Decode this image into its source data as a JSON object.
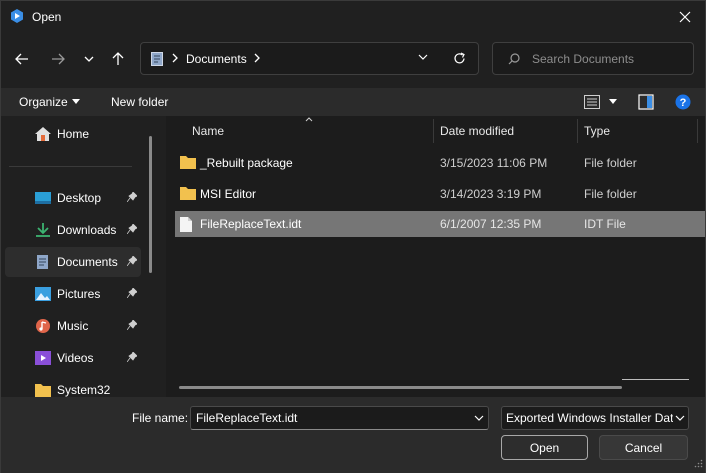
{
  "window": {
    "title": "Open"
  },
  "address": {
    "segment": "Documents"
  },
  "search": {
    "placeholder": "Search Documents"
  },
  "commands": {
    "organize": "Organize",
    "new_folder": "New folder"
  },
  "sidebar": {
    "items": [
      {
        "label": "Home",
        "icon": "home-icon",
        "pinned": false
      },
      {
        "label": "Desktop",
        "icon": "desktop-icon",
        "pinned": true
      },
      {
        "label": "Downloads",
        "icon": "downloads-icon",
        "pinned": true
      },
      {
        "label": "Documents",
        "icon": "documents-icon",
        "pinned": true,
        "selected": true
      },
      {
        "label": "Pictures",
        "icon": "pictures-icon",
        "pinned": true
      },
      {
        "label": "Music",
        "icon": "music-icon",
        "pinned": true
      },
      {
        "label": "Videos",
        "icon": "videos-icon",
        "pinned": true
      },
      {
        "label": "System32",
        "icon": "folder-icon",
        "pinned": false
      }
    ]
  },
  "columns": {
    "name": "Name",
    "date": "Date modified",
    "type": "Type"
  },
  "files": [
    {
      "name": "_Rebuilt package",
      "date": "3/15/2023 11:06 PM",
      "type": "File folder",
      "kind": "folder"
    },
    {
      "name": "MSI Editor",
      "date": "3/14/2023 3:19 PM",
      "type": "File folder",
      "kind": "folder"
    },
    {
      "name": "FileReplaceText.idt",
      "date": "6/1/2007 12:35 PM",
      "type": "IDT File",
      "kind": "file",
      "selected": true
    }
  ],
  "footer": {
    "file_name_label": "File name:",
    "file_name_value": "FileReplaceText.idt",
    "file_type": "Exported Windows Installer Dat",
    "open_label": "Open",
    "cancel_label": "Cancel"
  },
  "colors": {
    "accent": "#1a73e8",
    "folder": "#f2c14e",
    "selected_row": "#767676"
  }
}
